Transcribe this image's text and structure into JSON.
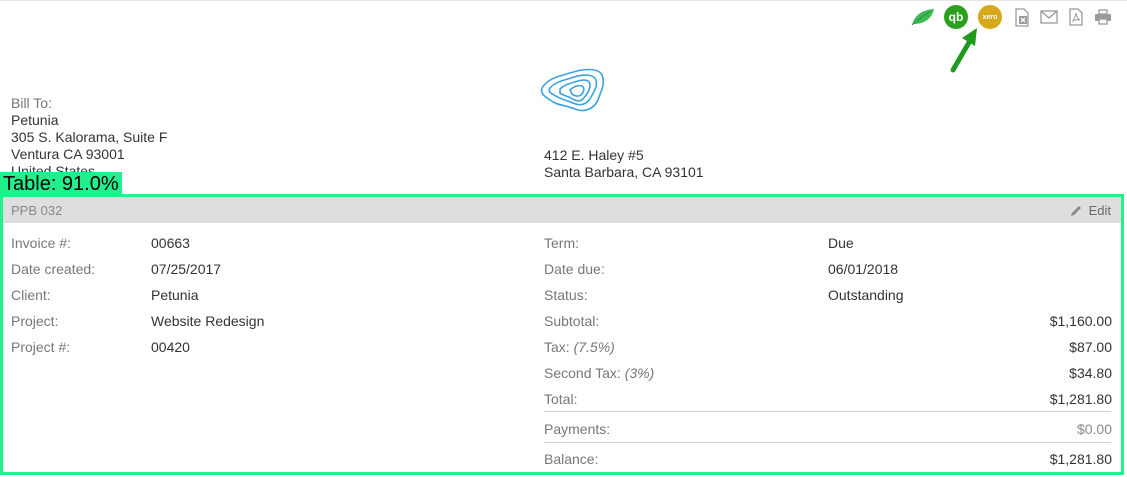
{
  "toolbar": {
    "icons": [
      "leaf-icon",
      "quickbooks-icon",
      "xero-icon",
      "excel-icon",
      "email-icon",
      "pdf-icon",
      "print-icon"
    ],
    "quickbooks_text": "qb",
    "xero_text": "xero",
    "colors": {
      "leaf": "#3cba54",
      "quickbooks": "#2ca01c",
      "xero": "#d6a91a",
      "icon_gray": "#9a9a9a"
    }
  },
  "annotation": {
    "arrow_color": "#1f9a1f",
    "detection_label": "Table: 91.0%",
    "detection_color": "#22f08d"
  },
  "bill_to": {
    "label": "Bill To:",
    "name": "Petunia",
    "address_line1": "305 S. Kalorama, Suite F",
    "address_line2": "Ventura CA 93001",
    "country": "United States"
  },
  "company": {
    "logo": "topographic-logo",
    "logo_color": "#3aa3e0",
    "address_line1": "412 E. Haley #5",
    "address_line2": "Santa Barbara, CA 93101"
  },
  "invoice": {
    "header_title": "PPB 032",
    "edit_label": "Edit",
    "left": [
      {
        "label": "Invoice #:",
        "value": "00663"
      },
      {
        "label": "Date created:",
        "value": "07/25/2017"
      },
      {
        "label": "Client:",
        "value": "Petunia"
      },
      {
        "label": "Project:",
        "value": "Website Redesign"
      },
      {
        "label": "Project #:",
        "value": "00420"
      }
    ],
    "right": [
      {
        "label": "Term:",
        "value": "Due"
      },
      {
        "label": "Date due:",
        "value": "06/01/2018"
      },
      {
        "label": "Status:",
        "value": "Outstanding"
      }
    ],
    "totals": {
      "subtotal": {
        "label": "Subtotal:",
        "value": "$1,160.00"
      },
      "tax": {
        "label": "Tax:",
        "rate": "(7.5%)",
        "value": "$87.00"
      },
      "second_tax": {
        "label": "Second Tax:",
        "rate": "(3%)",
        "value": "$34.80"
      },
      "total": {
        "label": "Total:",
        "value": "$1,281.80"
      },
      "payments": {
        "label": "Payments:",
        "value": "$0.00"
      },
      "balance": {
        "label": "Balance:",
        "value": "$1,281.80"
      }
    }
  }
}
